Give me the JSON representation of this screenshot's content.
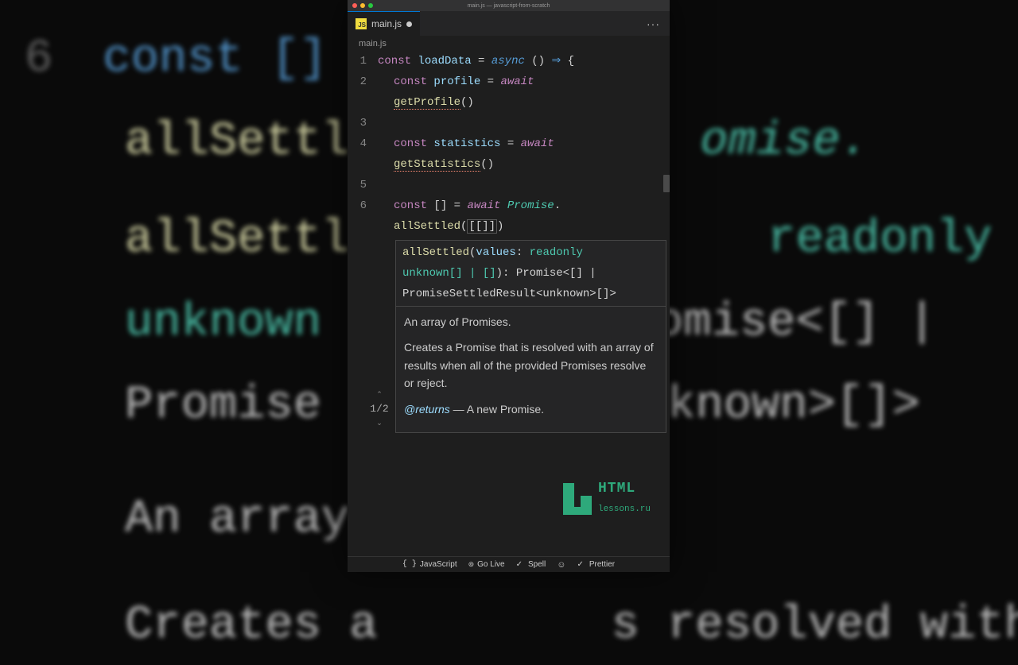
{
  "window": {
    "title": "main.js — javascript-from-scratch"
  },
  "tab": {
    "filename": "main.js",
    "icon_label": "JS"
  },
  "breadcrumb": "main.js",
  "gutter": [
    "1",
    "2",
    "3",
    "4",
    "5",
    "6"
  ],
  "code": {
    "l1": {
      "const": "const",
      "name": "loadData",
      "eq": "=",
      "async": "async",
      "parens": "()",
      "arrow": "⇒",
      "brace": "{"
    },
    "l2": {
      "const": "const",
      "name": "profile",
      "eq": "=",
      "await": "await"
    },
    "l2w": {
      "fn": "getProfile",
      "call": "()"
    },
    "l4": {
      "const": "const",
      "name": "statistics",
      "eq": "=",
      "await": "await"
    },
    "l4w": {
      "fn": "getStatistics",
      "call": "()"
    },
    "l6": {
      "const": "const",
      "arr": "[]",
      "eq": "=",
      "await": "await",
      "promise": "Promise",
      "dot": "."
    },
    "l6w": {
      "fn": "allSettled",
      "open": "(",
      "inner": "[[]]",
      "close": ")"
    }
  },
  "tooltip": {
    "counter": "1/2",
    "sig": {
      "name": "allSettled",
      "open": "(",
      "param": "values",
      "colon": ": ",
      "ptype1": "readonly",
      "ptype2": "unknown[] | []",
      "close": "): ",
      "ret": "Promise<[] | PromiseSettledResult<unknown>[]>"
    },
    "doc_p1": "An array of Promises.",
    "doc_p2": "Creates a Promise that is resolved with an array of results when all of the provided Promises resolve or reject.",
    "doc_tag": "@returns",
    "doc_ret": " — A new Promise."
  },
  "watermark": {
    "line1": "HTML",
    "line2": "lessons.ru"
  },
  "statusbar": {
    "lang": "JavaScript",
    "golive": "Go Live",
    "spell": "Spell",
    "prettier": "Prettier"
  },
  "bg": {
    "l1_num": "6",
    "l1": "const [] = ",
    "l2": "allSettl",
    "l2r": "omise.",
    "l3a": "allSettled(",
    "l3b": "readonly",
    "l4a": "unknown",
    "l4b": "omise<[] |",
    "l5": "Promise",
    "l5r": "t<unknown>[]>",
    "l6": "An array",
    "l7a": "Creates a",
    "l7b": "s resolved with"
  }
}
